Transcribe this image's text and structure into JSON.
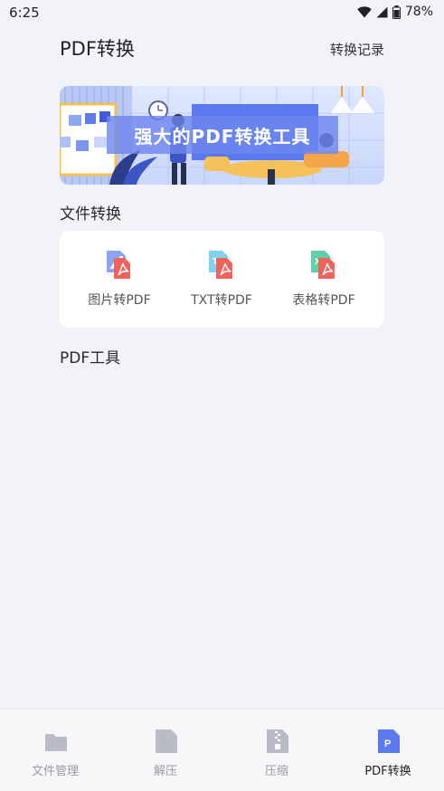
{
  "status_bar": {
    "time": "6:25",
    "battery": "78%"
  },
  "header": {
    "title": "PDF转换",
    "history_label": "转换记录"
  },
  "banner": {
    "caption": "强大的PDF转换工具"
  },
  "sections": {
    "file_convert": "文件转换",
    "pdf_tools": "PDF工具"
  },
  "tools": [
    {
      "label": "图片转PDF",
      "icon": "image-to-pdf-icon"
    },
    {
      "label": "TXT转PDF",
      "icon": "txt-to-pdf-icon"
    },
    {
      "label": "表格转PDF",
      "icon": "excel-to-pdf-icon"
    }
  ],
  "bottom_nav": [
    {
      "label": "文件管理",
      "icon": "folder-icon"
    },
    {
      "label": "解压",
      "icon": "file-icon"
    },
    {
      "label": "压缩",
      "icon": "zip-file-icon"
    },
    {
      "label": "PDF转换",
      "icon": "pdf-file-icon",
      "active": true
    }
  ],
  "colors": {
    "accent": "#5b79f0",
    "pdf_red": "#f0625c",
    "inactive": "#b9bcc6"
  }
}
